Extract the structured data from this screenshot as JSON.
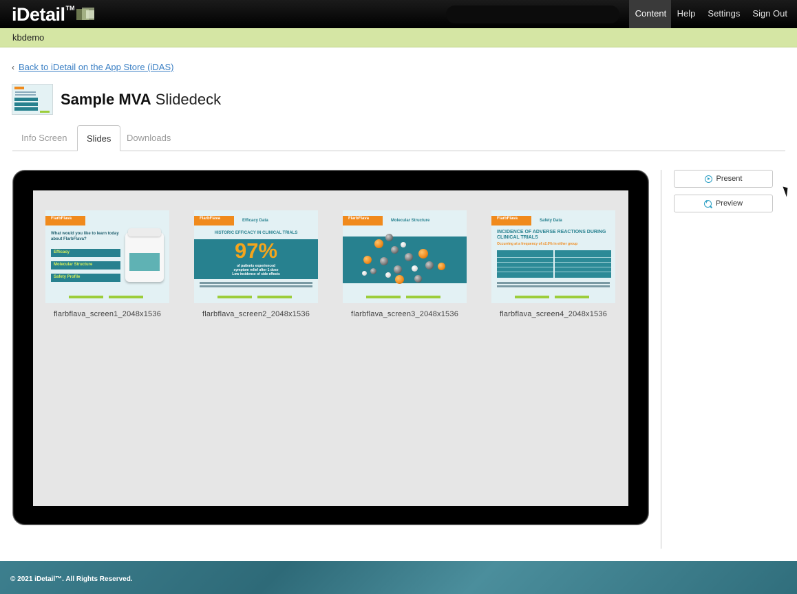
{
  "app": {
    "logo_text": "iDetail",
    "logo_tm": "TM"
  },
  "nav": {
    "items": [
      {
        "label": "Content",
        "active": true
      },
      {
        "label": "Help"
      },
      {
        "label": "Settings"
      },
      {
        "label": "Sign Out"
      }
    ]
  },
  "user": {
    "name": "kbdemo"
  },
  "back_link": {
    "label": "Back to iDetail on the App Store (iDAS)"
  },
  "title": {
    "bold": "Sample MVA",
    "light": "Slidedeck"
  },
  "tabs": [
    {
      "label": "Info Screen"
    },
    {
      "label": "Slides",
      "active": true
    },
    {
      "label": "Downloads"
    }
  ],
  "slides": [
    {
      "caption": "flarbflava_screen1_2048x1536",
      "brand": "FlarbFlava",
      "question": "What would you like to learn today about FlarbFlava?",
      "buttons": [
        "Efficacy",
        "Molecular Structure",
        "Safety Profile"
      ]
    },
    {
      "caption": "flarbflava_screen2_2048x1536",
      "brand": "FlarbFlava",
      "heading": "Efficacy Data",
      "headline": "HISTORIC EFFICACY IN CLINICAL TRIALS",
      "percent": "97%",
      "sub1": "of patients experienced",
      "sub2": "symptom relief after 1 dose",
      "sub3": "Low incidence of side effects"
    },
    {
      "caption": "flarbflava_screen3_2048x1536",
      "brand": "FlarbFlava",
      "heading": "Molecular Structure"
    },
    {
      "caption": "flarbflava_screen4_2048x1536",
      "brand": "FlarbFlava",
      "heading": "Safety Data",
      "headline": "INCIDENCE OF ADVERSE REACTIONS DURING CLINICAL TRIALS",
      "sub": "Occurring at a frequency of ≥2.0% in either group"
    }
  ],
  "sidebar": {
    "present_label": "Present",
    "preview_label": "Preview"
  },
  "footer": {
    "copyright": "© 2021 iDetail™.  All Rights Reserved."
  },
  "colors": {
    "accent_teal": "#27818f",
    "brand_orange": "#f08a1c",
    "userbar_green": "#d5e6a4",
    "link_blue": "#3a7fc4"
  }
}
